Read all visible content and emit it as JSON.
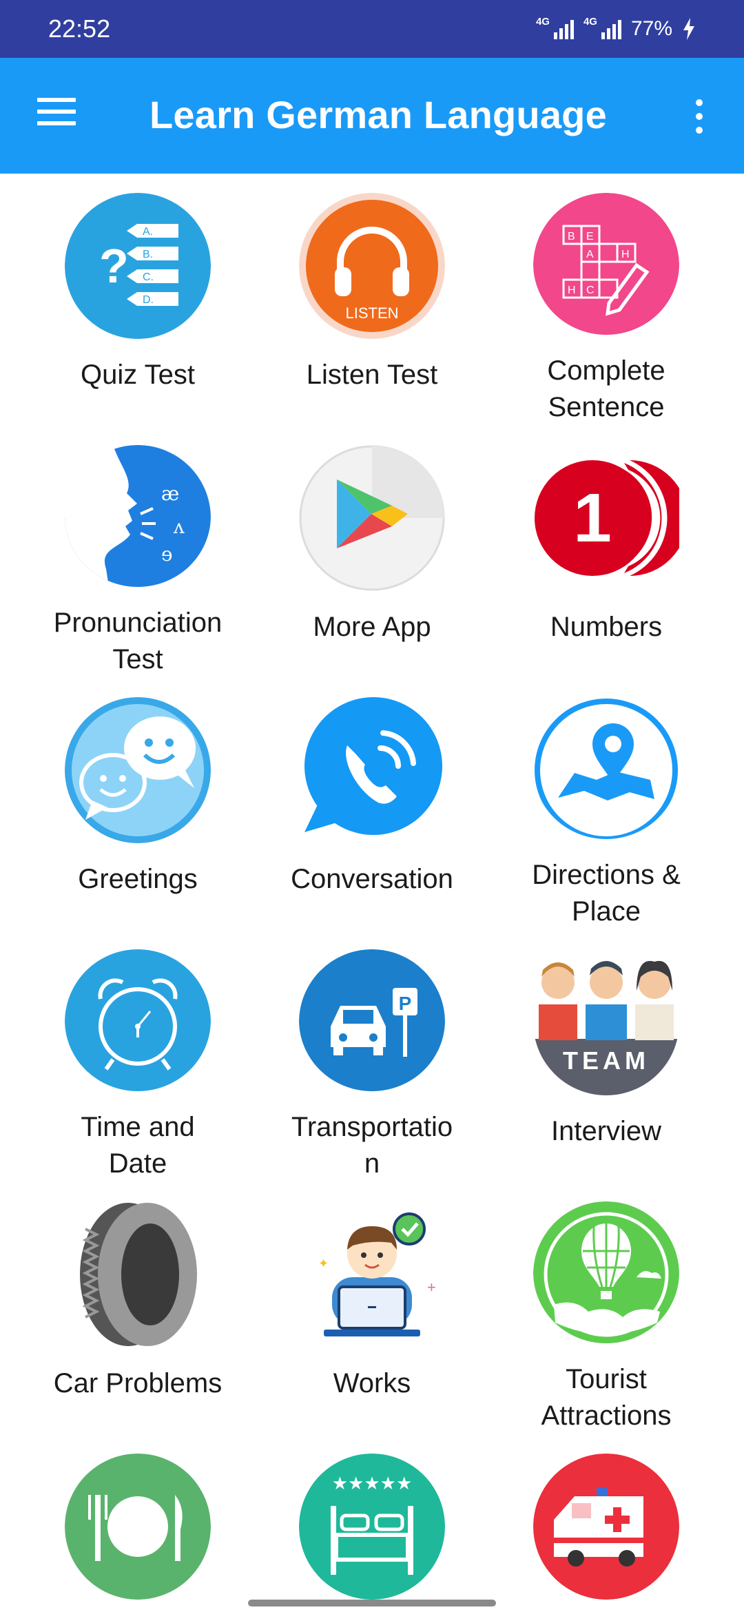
{
  "status_bar": {
    "time": "22:52",
    "network_1": "4G",
    "network_2": "4G",
    "battery": "77%"
  },
  "app_bar": {
    "title": "Learn German Language",
    "menu_icon": "hamburger-menu-icon",
    "overflow_icon": "more-vertical-icon",
    "color": "#1a9af7"
  },
  "tiles": [
    {
      "label": "Quiz Test",
      "icon": "quiz-icon"
    },
    {
      "label": "Listen Test",
      "icon": "headphones-icon",
      "icon_text": "LISTEN"
    },
    {
      "label": "Complete\nSentence",
      "icon": "crossword-icon"
    },
    {
      "label": "Pronunciation\nTest",
      "icon": "face-speaking-icon"
    },
    {
      "label": "More App",
      "icon": "play-store-icon"
    },
    {
      "label": "Numbers",
      "icon": "number-one-icon",
      "icon_text": "1"
    },
    {
      "label": "Greetings",
      "icon": "chat-smiley-icon"
    },
    {
      "label": "Conversation",
      "icon": "phone-call-icon"
    },
    {
      "label": "Directions &\nPlace",
      "icon": "map-pin-icon"
    },
    {
      "label": "Time and\nDate",
      "icon": "alarm-clock-icon"
    },
    {
      "label": "Transportatio\nn",
      "icon": "car-parking-icon",
      "icon_text": "P"
    },
    {
      "label": "Interview",
      "icon": "team-icon",
      "icon_text": "TEAM"
    },
    {
      "label": "Car Problems",
      "icon": "tire-icon"
    },
    {
      "label": "Works",
      "icon": "worker-laptop-icon"
    },
    {
      "label": "Tourist\nAttractions",
      "icon": "hot-air-balloon-icon"
    },
    {
      "label": "",
      "icon": "restaurant-plate-icon"
    },
    {
      "label": "",
      "icon": "hotel-bed-icon",
      "icon_text": "★★★★★"
    },
    {
      "label": "",
      "icon": "ambulance-icon"
    }
  ]
}
